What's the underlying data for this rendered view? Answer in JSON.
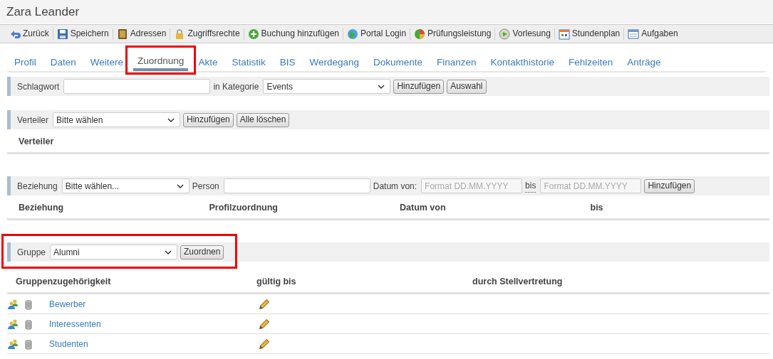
{
  "title": "Zara Leander",
  "toolbar": [
    {
      "label": "Zurück"
    },
    {
      "label": "Speichern"
    },
    {
      "label": "Adressen"
    },
    {
      "label": "Zugriffsrechte"
    },
    {
      "label": "Buchung hinzufügen"
    },
    {
      "label": "Portal Login"
    },
    {
      "label": "Prüfungsleistung"
    },
    {
      "label": "Vorlesung"
    },
    {
      "label": "Stundenplan"
    },
    {
      "label": "Aufgaben"
    }
  ],
  "tabs": [
    {
      "label": "Profil",
      "selected": false,
      "highlighted": false
    },
    {
      "label": "Daten",
      "selected": false,
      "highlighted": false
    },
    {
      "label": "Weitere",
      "selected": false,
      "highlighted": false
    },
    {
      "label": "Zuordnung",
      "selected": true,
      "highlighted": true
    },
    {
      "label": "Akte",
      "selected": false,
      "highlighted": false
    },
    {
      "label": "Statistik",
      "selected": false,
      "highlighted": false
    },
    {
      "label": "BIS",
      "selected": false,
      "highlighted": false
    },
    {
      "label": "Werdegang",
      "selected": false,
      "highlighted": false
    },
    {
      "label": "Dokumente",
      "selected": false,
      "highlighted": false
    },
    {
      "label": "Finanzen",
      "selected": false,
      "highlighted": false
    },
    {
      "label": "Kontakthistorie",
      "selected": false,
      "highlighted": false
    },
    {
      "label": "Fehlzeiten",
      "selected": false,
      "highlighted": false
    },
    {
      "label": "Anträge",
      "selected": false,
      "highlighted": false
    }
  ],
  "sections": [
    {
      "kind": "form",
      "highlighted": false,
      "controls": [
        {
          "kind": "label",
          "text": "Schlagwort"
        },
        {
          "kind": "input"
        },
        {
          "kind": "label",
          "text": "in Kategorie"
        },
        {
          "kind": "select",
          "value": "Events"
        },
        {
          "kind": "button",
          "text": "Hinzufügen"
        },
        {
          "kind": "button",
          "text": "Auswahl"
        }
      ]
    },
    {
      "kind": "form",
      "highlighted": false,
      "controls": [
        {
          "kind": "label",
          "text": "Verteiler"
        },
        {
          "kind": "select",
          "value": "Bitte wählen"
        },
        {
          "kind": "button",
          "text": "Hinzufügen"
        },
        {
          "kind": "button",
          "text": "Alle löschen"
        }
      ]
    },
    {
      "kind": "table",
      "columns": [
        "Verteiler"
      ]
    },
    {
      "kind": "form",
      "highlighted": false,
      "controls": [
        {
          "kind": "label",
          "text": "Beziehung"
        },
        {
          "kind": "select",
          "value": "Bitte wählen..."
        },
        {
          "kind": "label",
          "text": "Person"
        },
        {
          "kind": "input"
        },
        {
          "kind": "label",
          "text": "Datum von:"
        },
        {
          "kind": "input",
          "placeholder": "Format DD.MM.YYYY"
        },
        {
          "kind": "abbr",
          "text": "bis"
        },
        {
          "kind": "input",
          "placeholder": "Format DD.MM.YYYY"
        },
        {
          "kind": "button",
          "text": "Hinzufügen"
        }
      ]
    },
    {
      "kind": "table",
      "columns": [
        "Beziehung",
        "Profilzuordnung",
        "Datum von",
        "bis"
      ]
    },
    {
      "kind": "form",
      "highlighted": true,
      "controls": [
        {
          "kind": "label",
          "text": "Gruppe"
        },
        {
          "kind": "select",
          "value": "Alumni"
        },
        {
          "kind": "button",
          "text": "Zuordnen"
        }
      ]
    },
    {
      "kind": "table",
      "columns": [
        "Gruppenzugehörigkeit",
        "gültig bis",
        "durch Stellvertretung"
      ],
      "rows": [
        {
          "name": "Bewerber"
        },
        {
          "name": "Interessenten"
        },
        {
          "name": "Studenten"
        }
      ]
    }
  ]
}
